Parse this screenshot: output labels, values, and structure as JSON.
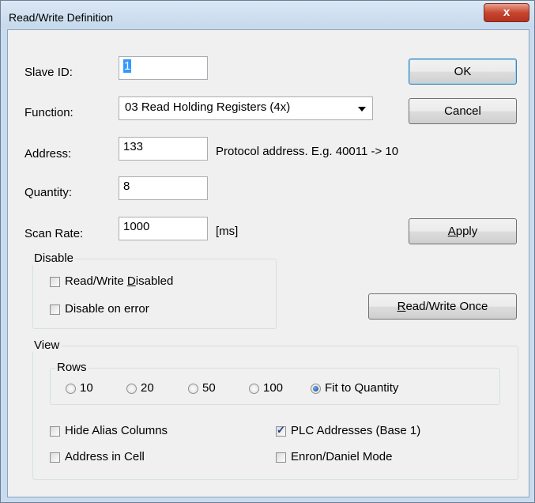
{
  "window": {
    "title": "Read/Write Definition",
    "close_glyph": "x"
  },
  "form": {
    "slave_id": {
      "label": "Slave ID:",
      "value": "1"
    },
    "function": {
      "label": "Function:",
      "value": "03 Read Holding Registers (4x)"
    },
    "address": {
      "label": "Address:",
      "value": "133",
      "hint": "Protocol address. E.g. 40011 -> 10"
    },
    "quantity": {
      "label": "Quantity:",
      "value": "8"
    },
    "scan_rate": {
      "label": "Scan Rate:",
      "value": "1000",
      "unit": "[ms]"
    }
  },
  "buttons": {
    "ok": "OK",
    "cancel": "Cancel",
    "apply_pre": "",
    "apply_key": "A",
    "apply_post": "pply",
    "rwonce_pre": "",
    "rwonce_key": "R",
    "rwonce_post": "ead/Write Once"
  },
  "disable": {
    "title": "Disable",
    "rw_disabled_pre": "Read/Write ",
    "rw_disabled_key": "D",
    "rw_disabled_post": "isabled",
    "rw_disabled_checked": false,
    "on_error": "Disable on error",
    "on_error_checked": false
  },
  "view": {
    "title": "View",
    "rows": {
      "title": "Rows",
      "options": [
        "10",
        "20",
        "50",
        "100",
        "Fit to Quantity"
      ],
      "selected": "Fit to Quantity"
    },
    "hide_alias": {
      "label": "Hide Alias Columns",
      "checked": false
    },
    "plc_addresses": {
      "label": "PLC Addresses (Base 1)",
      "checked": true
    },
    "address_in_cell": {
      "label": "Address in Cell",
      "checked": false
    },
    "enron_mode": {
      "label": "Enron/Daniel Mode",
      "checked": false
    }
  }
}
